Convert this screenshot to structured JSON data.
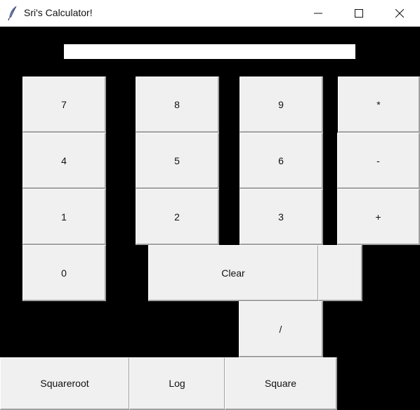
{
  "window": {
    "title": "Sri's Calculator!",
    "icon": "feather-icon"
  },
  "display": {
    "value": ""
  },
  "buttons": {
    "seven": "7",
    "eight": "8",
    "nine": "9",
    "multiply": "*",
    "four": "4",
    "five": "5",
    "six": "6",
    "subtract": "-",
    "one": "1",
    "two": "2",
    "three": "3",
    "add": "+",
    "zero": "0",
    "clear": "Clear",
    "blank": "",
    "divide": "/",
    "squareroot": "Squareroot",
    "log": "Log",
    "square": "Square"
  },
  "colors": {
    "background": "#000000",
    "button": "#f0f0f0",
    "display": "#ffffff"
  }
}
